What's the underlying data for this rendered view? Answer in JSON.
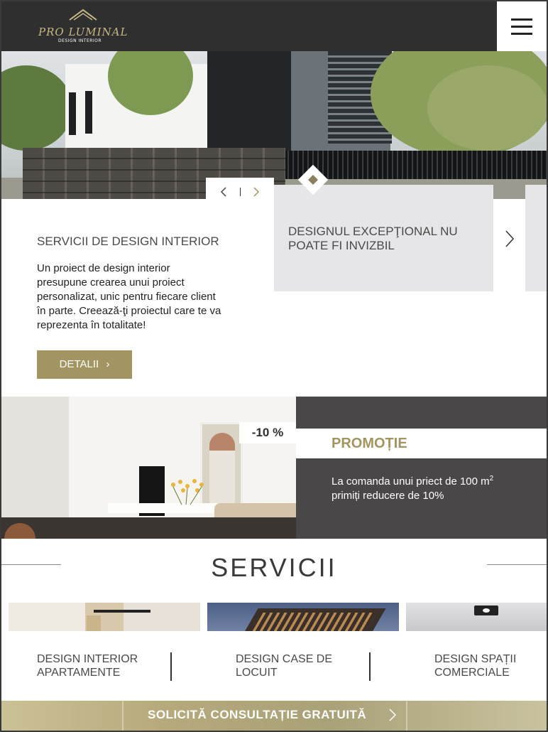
{
  "header": {
    "logo_text": "PRO LUMINAL",
    "logo_subtext": "DESIGN INTERIOR"
  },
  "hero": {
    "slide_title": "DESIGNUL EXCEPŢIONAL NU POATE FI INVIZBIL"
  },
  "intro": {
    "heading": "SERVICII DE DESIGN INTERIOR",
    "text": "Un proiect de design interior presupune crearea unui proiect personalizat, unic pentru fiecare client în parte. Creează-ţi proiectul care te va reprezenta în totalitate!",
    "button_label": "DETALII",
    "button_arrow": "›"
  },
  "promo": {
    "discount_badge": "-10 %",
    "label": "PROMOȚIE",
    "text_main": "La comanda unui priect de 100 m",
    "text_sup": "2",
    "text_end": "primiți reducere de 10%"
  },
  "services": {
    "title": "SERVICII",
    "items": [
      {
        "label": "DESIGN INTERIOR APARTAMENTE"
      },
      {
        "label": "DESIGN CASE DE LOCUIT"
      },
      {
        "label": "DESIGN SPAȚII COMERCIALE"
      }
    ]
  },
  "cta": {
    "label": "SOLICITĂ CONSULTAȚIE GRATUITĂ"
  },
  "colors": {
    "dark": "#302f30",
    "gold": "#a39561",
    "promo_panel": "#4a4748",
    "card_bg": "#e6e6e8"
  },
  "icons": [
    "hamburger-menu-icon",
    "chevron-left-icon",
    "chevron-right-icon",
    "diamond-icon"
  ]
}
